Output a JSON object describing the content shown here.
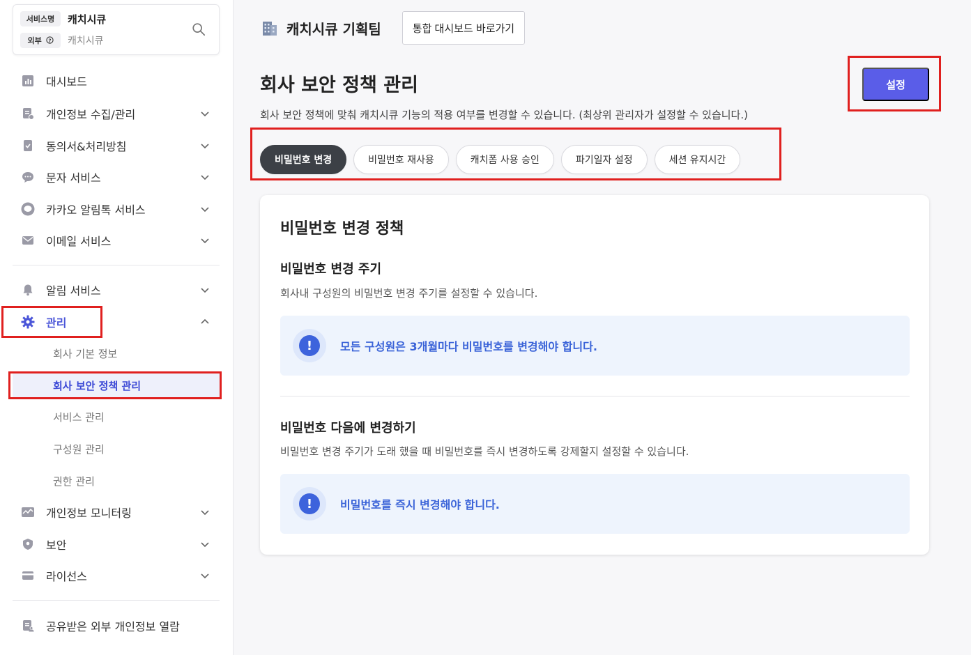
{
  "service": {
    "tag_name": "서비스명",
    "name": "캐치시큐",
    "tag_scope": "외부",
    "scope_icon": "help-circle-icon",
    "sub": "캐치시큐"
  },
  "nav": {
    "dashboard": "대시보드",
    "privacy_collect": "개인정보 수집/관리",
    "consent": "동의서&처리방침",
    "sms": "문자 서비스",
    "kakao": "카카오 알림톡 서비스",
    "email": "이메일 서비스",
    "alarm": "알림 서비스",
    "manage": "관리",
    "manage_sub": {
      "company_info": "회사 기본 정보",
      "security_policy": "회사 보안 정책 관리",
      "service_manage": "서비스 관리",
      "member_manage": "구성원 관리",
      "permission_manage": "권한 관리"
    },
    "monitoring": "개인정보 모니터링",
    "security": "보안",
    "license": "라이선스",
    "shared": "공유받은 외부 개인정보 열람"
  },
  "header": {
    "team_name": "캐치시큐 기획팀",
    "dashboard_shortcut": "통합 대시보드 바로가기"
  },
  "page": {
    "title": "회사 보안 정책 관리",
    "description": "회사 보안 정책에 맞춰 캐치시큐 기능의 적용 여부를 변경할 수 있습니다. (최상위 관리자가 설정할 수 있습니다.)",
    "setting_button": "설정"
  },
  "tabs": [
    "비밀번호 변경",
    "비밀번호 재사용",
    "캐치폼 사용 승인",
    "파기일자 설정",
    "세션 유지시간"
  ],
  "card": {
    "title": "비밀번호 변경 정책",
    "section1": {
      "title": "비밀번호 변경 주기",
      "desc": "회사내 구성원의 비밀번호 변경 주기를 설정할 수 있습니다.",
      "info": "모든 구성원은 3개월마다 비밀번호를 변경해야 합니다."
    },
    "section2": {
      "title": "비밀번호 다음에 변경하기",
      "desc": "비밀번호 변경 주기가 도래 했을 때 비밀번호를 즉시 변경하도록 강제할지 설정할 수 있습니다.",
      "info": "비밀번호를 즉시 변경해야 합니다."
    },
    "info_icon_glyph": "!"
  },
  "colors": {
    "accent": "#5a5de8",
    "active_nav": "#4a55d8",
    "highlight": "#e0201f",
    "info_bg": "#eef4fd",
    "info_text": "#3a63d8"
  }
}
